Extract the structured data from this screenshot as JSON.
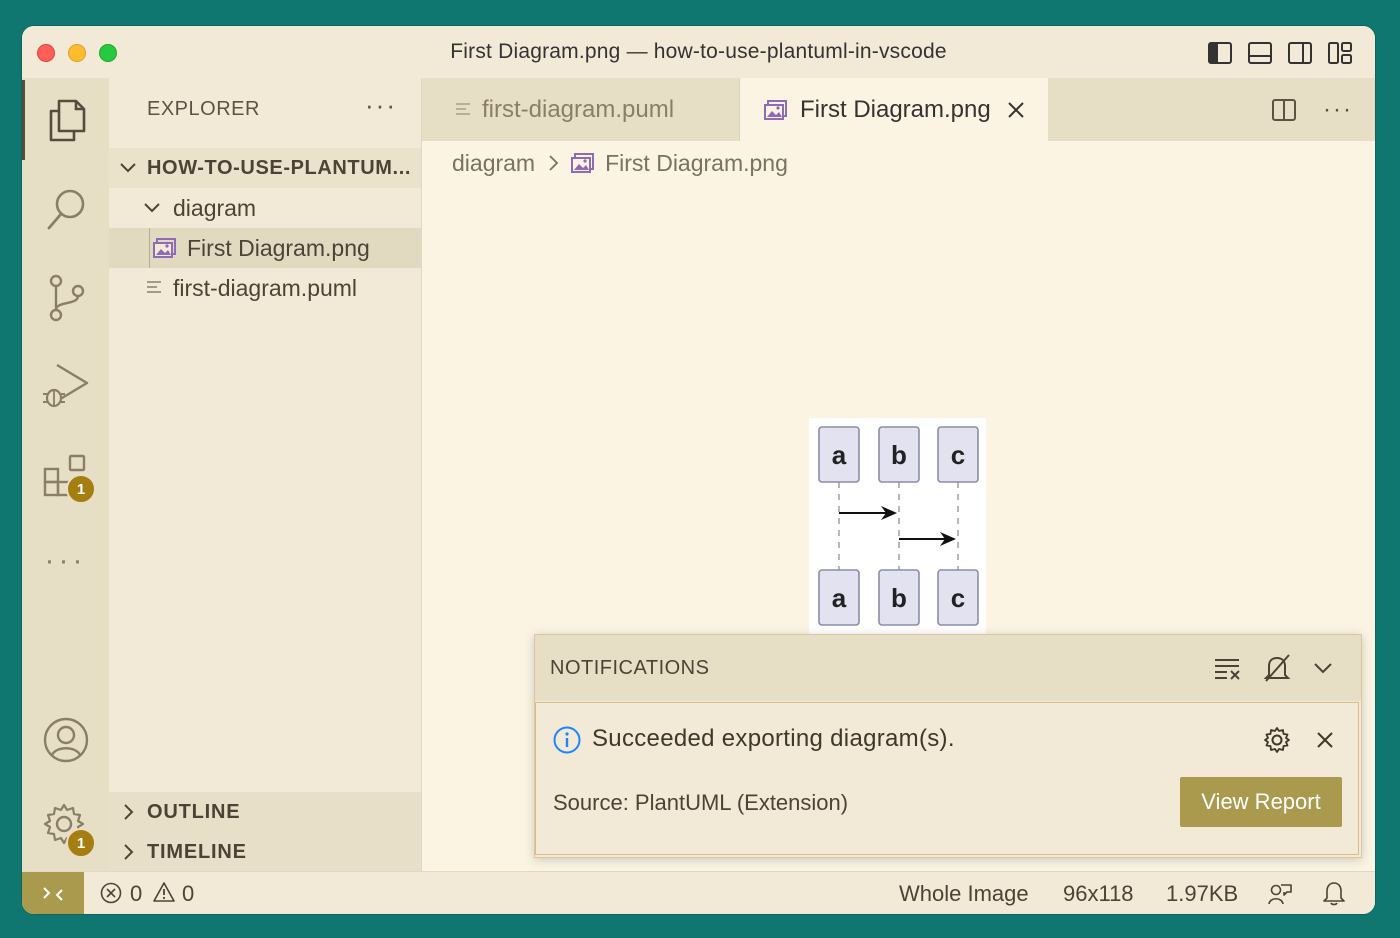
{
  "window": {
    "title": "First Diagram.png — how-to-use-plantuml-in-vscode"
  },
  "activity_bar": {
    "items": [
      {
        "name": "explorer",
        "icon": "files-icon"
      },
      {
        "name": "search",
        "icon": "search-icon"
      },
      {
        "name": "source-control",
        "icon": "source-control-icon"
      },
      {
        "name": "run-debug",
        "icon": "run-debug-icon"
      },
      {
        "name": "extensions",
        "icon": "extensions-icon",
        "badge": "1"
      },
      {
        "name": "more",
        "icon": "more-icon"
      }
    ],
    "bottom": [
      {
        "name": "accounts",
        "icon": "account-icon"
      },
      {
        "name": "manage",
        "icon": "gear-icon",
        "badge": "1"
      }
    ]
  },
  "sidebar": {
    "header": "EXPLORER",
    "more": "···",
    "root_folder": "HOW-TO-USE-PLANTUM...",
    "tree": [
      {
        "label": "diagram",
        "type": "folder"
      },
      {
        "label": "First Diagram.png",
        "type": "image"
      },
      {
        "label": "first-diagram.puml",
        "type": "file"
      }
    ],
    "sections": [
      "OUTLINE",
      "TIMELINE"
    ]
  },
  "tabs": [
    {
      "label": "first-diagram.puml",
      "active": false
    },
    {
      "label": "First Diagram.png",
      "active": true
    }
  ],
  "breadcrumb": {
    "folder": "diagram",
    "separator": ">",
    "file": "First Diagram.png"
  },
  "diagram": {
    "participants": [
      "a",
      "b",
      "c"
    ]
  },
  "notifications": {
    "title": "NOTIFICATIONS",
    "message": "Succeeded exporting diagram(s).",
    "source": "Source: PlantUML (Extension)",
    "action": "View Report"
  },
  "status_bar": {
    "errors": "0",
    "warnings": "0",
    "zoom": "Whole Image",
    "dimensions": "96x118",
    "size": "1.97KB"
  },
  "colors": {
    "accent": "#a99a4e",
    "badge": "#a67d10",
    "background": "#fbf4e2",
    "sidebar": "#f2ead6"
  }
}
